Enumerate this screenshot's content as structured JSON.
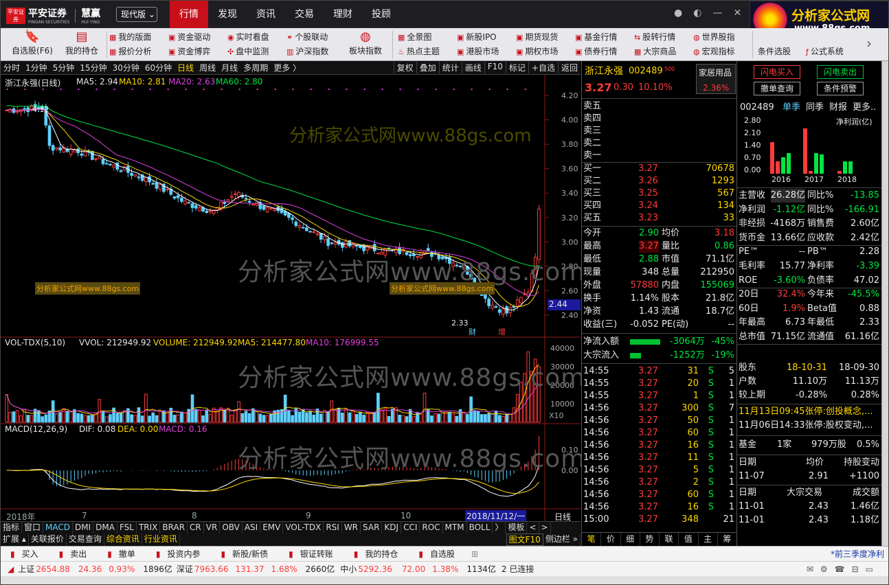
{
  "app": {
    "logo_mark": "平安证券",
    "logo_name": "平安证券",
    "logo_sub": "PINGAN SECURITIES",
    "logo_product": "慧赢",
    "logo_product_sub": "HUI YING",
    "version_button": "现代版 ⌄"
  },
  "main_nav": [
    "行情",
    "发现",
    "资讯",
    "交易",
    "理财",
    "投顾"
  ],
  "ad": {
    "line1": "分析家公式网",
    "line2": "www.88gs.com"
  },
  "toolbar": {
    "big1": "自选股(F6)",
    "big2": "我的持仓",
    "big3": "板块指数",
    "big4": "条件选股",
    "more": "›",
    "small": [
      [
        "我的版面",
        "报价分析"
      ],
      [
        "资金驱动",
        "资金博弈"
      ],
      [
        "实时看盘",
        "盘中监测"
      ],
      [
        "个股联动",
        "沪深指数"
      ],
      [
        "全景图",
        "热点主题"
      ],
      [
        "新股IPO",
        "港股市场"
      ],
      [
        "期货现货",
        "期权市场"
      ],
      [
        "基金行情",
        "债券行情"
      ],
      [
        "股转行情",
        "大宗商品"
      ],
      [
        "世界股指",
        "宏观指标"
      ],
      [
        "公式系统"
      ]
    ]
  },
  "period_bar": {
    "items": [
      "分时",
      "1分钟",
      "5分钟",
      "15分钟",
      "30分钟",
      "60分钟",
      "日线",
      "周线",
      "月线",
      "多周期",
      "更多 〉"
    ],
    "active": "日线",
    "right": [
      "复权",
      "叠加",
      "统计",
      "画线",
      "F10",
      "标记",
      "+自选",
      "返回"
    ]
  },
  "kline": {
    "name": "浙江永强(日线)",
    "ma5": "MA5: 2.94",
    "ma10": "MA10: 2.81",
    "ma20": "MA20: 2.63",
    "ma60": "MA60: 2.80",
    "hi_mark": "4.12",
    "lo_mark": "2.33",
    "price_tag": "2.44",
    "cai": "财",
    "zeng": "增",
    "yaxis": [
      "4.20",
      "4.00",
      "3.80",
      "3.60",
      "3.40",
      "3.20",
      "3.00",
      "2.80",
      "2.60",
      "2.40"
    ]
  },
  "volume": {
    "title": "VOL-TDX(5,10)",
    "vvol": "VVOL: 212949.92",
    "volume": "VOLUME: 212949.92",
    "ma5": "MA5: 214477.80",
    "ma10": "MA10: 176999.55",
    "yaxis": [
      "40000",
      "30000",
      "20000",
      "10000"
    ],
    "unit": "X10"
  },
  "macd": {
    "title": "MACD(12,26,9)",
    "dif": "DIF: 0.08",
    "dea": "DEA: 0.00",
    "macd": "MACD: 0.16",
    "yaxis": [
      "0.10",
      "0.00"
    ]
  },
  "xaxis": {
    "labels": [
      "2018年",
      "7",
      "8",
      "9",
      "10"
    ],
    "cursor": "2018/11/12/一",
    "period": "日线"
  },
  "watermarks": {
    "big": "分析家公式网www.88gs.com",
    "small1": "分析家公式网www.88gs.com",
    "small2": "分析家公式网www.88gs.com",
    "small3": "分析家公式网www.88gs.com"
  },
  "ind_tabs": [
    "指标",
    "窗口",
    "MACD",
    "DMI",
    "DMA",
    "FSL",
    "TRIX",
    "BRAR",
    "CR",
    "VR",
    "OBV",
    "ASI",
    "EMV",
    "VOL-TDX",
    "RSI",
    "WR",
    "SAR",
    "KDJ",
    "CCI",
    "ROC",
    "MTM",
    "BOLL",
    "〉",
    "模板",
    "<",
    ">"
  ],
  "ext_tabs": [
    "扩展 ▴",
    "关联报价",
    "交易查询",
    "综合资讯",
    "行业资讯"
  ],
  "ext_right": "图文F10",
  "ext_right2": "侧边栏 »",
  "quote": {
    "name": "浙江永强",
    "code": "002489",
    "mark": "500",
    "industry": "家居用品",
    "price": "3.27",
    "change": "0.30",
    "pct": "10.10%",
    "turnover_pct": "2.36%",
    "sell": [
      "卖五",
      "卖四",
      "卖三",
      "卖二",
      "卖一"
    ],
    "buy": [
      [
        "买一",
        "3.27",
        "70678"
      ],
      [
        "买二",
        "3.26",
        "1293"
      ],
      [
        "买三",
        "3.25",
        "567"
      ],
      [
        "买四",
        "3.24",
        "134"
      ],
      [
        "买五",
        "3.23",
        "33"
      ]
    ],
    "stats": [
      [
        "今开",
        "2.90",
        "均价",
        "3.18"
      ],
      [
        "最高",
        "3.27",
        "量比",
        "0.86"
      ],
      [
        "最低",
        "2.88",
        "市值",
        "71.1亿"
      ],
      [
        "现量",
        "348",
        "总量",
        "212950"
      ],
      [
        "外盘",
        "57880",
        "内盘",
        "155069"
      ],
      [
        "换手",
        "1.14%",
        "股本",
        "21.8亿"
      ],
      [
        "净资",
        "1.43",
        "流通",
        "18.7亿"
      ],
      [
        "收益(三)",
        "-0.052",
        "PE(动)",
        "--"
      ]
    ],
    "flow": [
      [
        "净流入额",
        "-3064万",
        "-45%"
      ],
      [
        "大宗流入",
        "-1252万",
        "-19%"
      ]
    ],
    "ticks": [
      [
        "14:55",
        "3.27",
        "31",
        "S",
        "5"
      ],
      [
        "14:55",
        "3.27",
        "20",
        "S",
        "1"
      ],
      [
        "14:55",
        "3.27",
        "1",
        "S",
        "1"
      ],
      [
        "14:56",
        "3.27",
        "300",
        "S",
        "7"
      ],
      [
        "14:56",
        "3.27",
        "50",
        "S",
        "1"
      ],
      [
        "14:56",
        "3.27",
        "60",
        "S",
        "1"
      ],
      [
        "14:56",
        "3.27",
        "16",
        "S",
        "1"
      ],
      [
        "14:56",
        "3.27",
        "11",
        "S",
        "1"
      ],
      [
        "14:56",
        "3.27",
        "5",
        "S",
        "1"
      ],
      [
        "14:56",
        "3.27",
        "2",
        "S",
        "1"
      ],
      [
        "14:56",
        "3.27",
        "60",
        "S",
        "1"
      ],
      [
        "14:56",
        "3.27",
        "16",
        "S",
        "1"
      ],
      [
        "15:00",
        "3.27",
        "348",
        "",
        "21"
      ]
    ],
    "tabs": [
      "笔",
      "价",
      "细",
      "势",
      "联",
      "值",
      "主",
      "筹"
    ]
  },
  "fin": {
    "btn_buy": "闪电买入",
    "btn_sell": "闪电卖出",
    "btn_query": "撤单查询",
    "btn_alert": "条件预警",
    "code": "002489",
    "tabs": [
      "单季",
      "同季",
      "财报",
      "更多.."
    ],
    "chart_title": "净利润(亿)",
    "chart_y": [
      "2.80",
      "2.10",
      "1.40",
      "0.70",
      "0.00"
    ],
    "chart_x": [
      "2016",
      "2017",
      "2018"
    ],
    "rows": [
      [
        "主营收",
        "26.28亿",
        "同比%",
        "-13.85"
      ],
      [
        "净利润",
        "-1.12亿",
        "同比%",
        "-166.91"
      ],
      [
        "非经损",
        "-4168万",
        "销售费",
        "2.60亿"
      ],
      [
        "货币金",
        "13.66亿",
        "应收款",
        "2.42亿"
      ],
      [
        "PE™",
        "--",
        "PB™",
        "2.28"
      ],
      [
        "毛利率",
        "15.77",
        "净利率",
        "-3.39"
      ],
      [
        "ROE",
        "-3.60%",
        "负债率",
        "47.02"
      ],
      [
        "20日",
        "32.4%",
        "今年来",
        "-45.5%"
      ],
      [
        "60日",
        "1.9%",
        "Beta值",
        "0.88"
      ],
      [
        "年最高",
        "6.73",
        "年最低",
        "2.33"
      ],
      [
        "总市值",
        "71.15亿",
        "流通值",
        "61.16亿"
      ]
    ],
    "holders_hdr": [
      "股东",
      "18-10-31",
      "18-09-30"
    ],
    "holders": [
      [
        "户数",
        "11.10万",
        "11.13万"
      ],
      [
        "较上期",
        "-0.28%",
        "0.28%"
      ]
    ],
    "news": [
      "11月13日09:45张停:创投概念,...",
      "11月06日14:33张停:股权变动,..."
    ],
    "fund": [
      "基金",
      "1家",
      "979万股",
      "0.5%"
    ],
    "tx_hdr": [
      "日期",
      "均价",
      "持股变动"
    ],
    "tx": [
      [
        "11-07",
        "2.91",
        "+1100"
      ]
    ],
    "blk_hdr": [
      "日期",
      "大宗交易",
      "成交额"
    ],
    "blk": [
      [
        "11-01",
        "2.43",
        "1.46亿"
      ],
      [
        "11-01",
        "2.43",
        "1.18亿"
      ]
    ]
  },
  "actionbar": [
    "买入",
    "卖出",
    "撤单",
    "投资内参",
    "新股/新债",
    "银证转账",
    "我的持仓",
    "自选股"
  ],
  "actionbar_right": "*前三季度净利",
  "status": {
    "sh_label": "上证",
    "sh": "2654.88",
    "sh_chg": "24.36",
    "sh_pct": "0.93%",
    "sh_amt": "1896亿",
    "sz_label": "深证",
    "sz": "7963.66",
    "sz_chg": "131.37",
    "sz_pct": "1.68%",
    "sz_amt": "2660亿",
    "zx_label": "中小",
    "zx": "5292.36",
    "zx_chg": "72.00",
    "zx_pct": "1.38%",
    "zx_amt": "1134亿",
    "conn": "2 已连接"
  },
  "colors": {
    "up": "#ff3b3b",
    "down": "#00e640",
    "accent": "#c8101a",
    "ma5": "#ffffff",
    "ma10": "#ffd800",
    "ma20": "#e040e0",
    "ma60": "#00e640"
  }
}
